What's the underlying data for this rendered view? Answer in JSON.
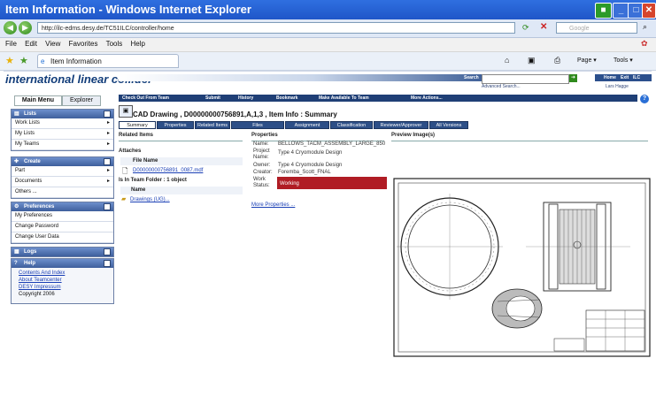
{
  "window": {
    "title": "Item Information - Windows Internet Explorer"
  },
  "address": {
    "url": "http://ilc-edms.desy.de/TC51ILC/controller/home",
    "search_placeholder": "Google"
  },
  "menu": {
    "file": "File",
    "edit": "Edit",
    "view": "View",
    "favorites": "Favorites",
    "tools": "Tools",
    "help": "Help"
  },
  "browser_tab": {
    "label": "Item Information"
  },
  "browser_toolbar": {
    "page": "Page",
    "tools": "Tools"
  },
  "header": {
    "logo": "international linear collider",
    "search_label": "Search",
    "advanced_search": "Advanced Search...",
    "home": "Home",
    "exit": "Exit",
    "ilc": "ILC",
    "user": "Lars Hagge"
  },
  "left_tabs": {
    "main_menu": "Main Menu",
    "explorer": "Explorer"
  },
  "panels": {
    "lists": {
      "title": "Lists",
      "items": [
        "Work Lists",
        "My Lists",
        "My Teams"
      ]
    },
    "create": {
      "title": "Create",
      "items": [
        "Part",
        "Documents",
        "Others ..."
      ]
    },
    "preferences": {
      "title": "Preferences",
      "items": [
        "My Preferences",
        "Change Password",
        "Change User Data"
      ]
    },
    "logs": {
      "title": "Logs"
    },
    "help": {
      "title": "Help",
      "links": [
        "Contents And Index",
        "About Teamcenter",
        "DESY Impressum"
      ],
      "copyright": "Copyright 2006"
    }
  },
  "actions": [
    "Check Out From Team",
    "Submit",
    "History",
    "Bookmark",
    "Make Available To Team",
    "More Actions..."
  ],
  "item": {
    "title": "CAD Drawing , D00000000756891,A,1,3 , Item Info : Summary"
  },
  "content_tabs": [
    "Summary",
    "Properties",
    "Related Items",
    "Files",
    "Assignment",
    "Classification",
    "Reviewer/Approver",
    "All Versions"
  ],
  "related": {
    "header": "Related Items",
    "attaches": "Attaches",
    "file_name_col": "File Name",
    "file": "D00000000756891_0087.mdf",
    "team_folder": "Is In Team Folder : 1 object",
    "name_col": "Name",
    "folder": "Drawings (UG)..."
  },
  "properties": {
    "header": "Properties",
    "name_label": "Name:",
    "name_value": "BELLOWS_TACM_ASSEMBLY_LARGE_850",
    "project_label": "Project Name:",
    "project_value": "Type 4 Cryomodule Design",
    "owner_label": "Owner:",
    "owner_value": "Type 4 Cryomodule Design",
    "creator_label": "Creator:",
    "creator_value": "Foremba_Scott_FNAL",
    "status_label": "Work Status:",
    "status_value": "Working",
    "more": "More Properties ..."
  },
  "preview": {
    "header": "Preview Image(s)"
  },
  "colors": {
    "title_bar": "#2f6fe0",
    "panel_header": "#4a6ead",
    "action_bar": "#1f3f76",
    "status": "#b01c24",
    "link": "#1a3fb5"
  }
}
